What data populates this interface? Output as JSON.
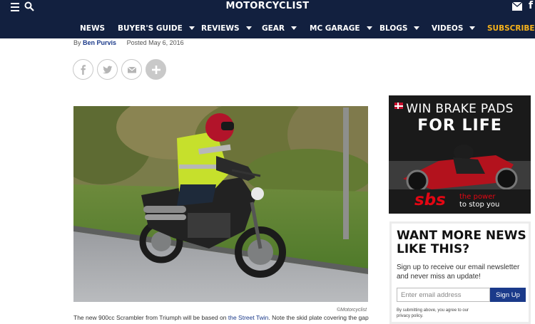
{
  "header": {
    "logo": "MOTORCYCLIST",
    "facebook_glyph": "f",
    "icons": [
      "hamburger-icon",
      "search-icon",
      "mail-icon",
      "facebook-icon"
    ],
    "colors": {
      "background": "#12203f",
      "subscribe": "#f6b21a"
    }
  },
  "nav": {
    "items": [
      {
        "label": "NEWS",
        "has_dropdown": false
      },
      {
        "label": "BUYER'S GUIDE",
        "has_dropdown": true
      },
      {
        "label": "REVIEWS",
        "has_dropdown": true
      },
      {
        "label": "GEAR",
        "has_dropdown": true
      },
      {
        "label": "MC GARAGE",
        "has_dropdown": true
      },
      {
        "label": "BLOGS",
        "has_dropdown": true
      },
      {
        "label": "VIDEOS",
        "has_dropdown": true
      }
    ],
    "subscribe": "SUBSCRIBE"
  },
  "article": {
    "by": "By",
    "author": "Ben Purvis",
    "posted": "Posted May 6, 2016",
    "share_icons": [
      "facebook-icon",
      "twitter-icon",
      "email-icon",
      "plus-icon"
    ],
    "image_credit": "©Motorcyclist",
    "caption_before": "The new 900cc Scrambler from Triumph will be based on ",
    "caption_link": "the Street Twin",
    "caption_after": ". Note the skid plate covering the gap"
  },
  "ad": {
    "line1": "WIN BRAKE PADS",
    "line2": "FOR LIFE",
    "brand": "sbs",
    "tagline_red": "the power",
    "tagline_white": "to stop you"
  },
  "newsletter": {
    "title": "WANT MORE NEWS LIKE THIS?",
    "text": "Sign up to receive our email newsletter and never miss an update!",
    "placeholder": "Enter email address",
    "button": "Sign Up",
    "fine_print": "By submitting above, you agree to our privacy policy."
  }
}
